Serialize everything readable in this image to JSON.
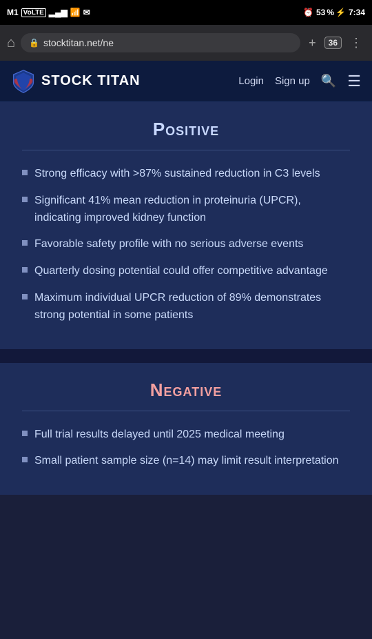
{
  "statusBar": {
    "carrier": "M1",
    "carrierType": "VoLTE",
    "time": "7:34",
    "batteryPercent": "53"
  },
  "browserChrome": {
    "addressText": "stocktitan.net/ne",
    "tabsCount": "36"
  },
  "nav": {
    "logoText": "STOCK TITAN",
    "loginLabel": "Login",
    "signupLabel": "Sign up"
  },
  "positiveSection": {
    "title": "Positive",
    "bullets": [
      "Strong efficacy with >87% sustained reduction in C3 levels",
      "Significant 41% mean reduction in proteinuria (UPCR), indicating improved kidney function",
      "Favorable safety profile with no serious adverse events",
      "Quarterly dosing potential could offer competitive advantage",
      "Maximum individual UPCR reduction of 89% demonstrates strong potential in some patients"
    ]
  },
  "negativeSection": {
    "title": "Negative",
    "bullets": [
      "Full trial results delayed until 2025 medical meeting",
      "Small patient sample size (n=14) may limit result interpretation"
    ]
  }
}
